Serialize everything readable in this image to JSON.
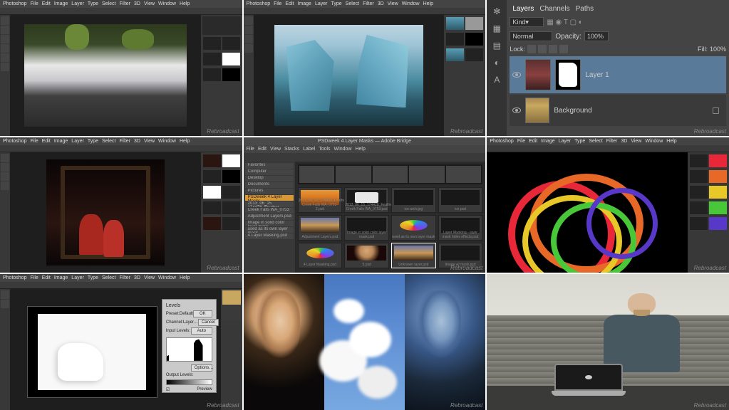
{
  "watermark": "Rebroadcast",
  "photoshop_menu": [
    "Photoshop",
    "File",
    "Edit",
    "Image",
    "Layer",
    "Type",
    "Select",
    "Filter",
    "3D",
    "View",
    "Window",
    "Help"
  ],
  "bridge_menu": [
    "File",
    "Edit",
    "View",
    "Stacks",
    "Label",
    "Tools",
    "Window",
    "Help"
  ],
  "bridge_title": "PSDweek 4 Layer Masks — Adobe Bridge",
  "layers_panel": {
    "tabs": [
      "Layers",
      "Channels",
      "Paths"
    ],
    "kind_label": "Kind",
    "blend_mode": "Normal",
    "opacity_label": "Opacity:",
    "opacity_value": "100%",
    "lock_label": "Lock:",
    "fill_label": "Fill:",
    "fill_value": "100%",
    "layer1_name": "Layer 1",
    "background_name": "Background"
  },
  "bridge_folders": [
    "Favorites",
    "Computer",
    "Desktop",
    "Documents",
    "Pictures",
    "PSDweek 4 Layer Masks",
    "2013_06_15 174428_Feather",
    "Creek Falls WA_0753",
    "Adjustment Layers.psd",
    "Image in solid color layer mask",
    "used as its own layer mask",
    "4 Layer Masking.psd"
  ],
  "bridge_thumbs": [
    "2013_06_15_174428_Feather Creek Falls WA_0753-2.psd",
    "2013_06_15_174428_Feather Creek Falls WA_0753.psd",
    "ice arch.jpg",
    "ice.psd",
    "Adjustment Layers.psd",
    "Image in solid color layer mask.psd",
    "used as its own layer mask",
    "Layer Masking - layer mask hides effects.psd",
    "4 Layer Masking.psd",
    "5.psd",
    "Unknown layer.psd",
    "Image w/ mask.psd"
  ],
  "levels_dialog": {
    "title": "Levels",
    "preset_label": "Preset:",
    "preset_value": "Default",
    "channel_label": "Channel:",
    "channel_value": "Layer…",
    "input_label": "Input Levels:",
    "output_label": "Output Levels:",
    "btn_ok": "OK",
    "btn_cancel": "Cancel",
    "btn_auto": "Auto",
    "btn_options": "Options…",
    "preview_label": "Preview"
  }
}
